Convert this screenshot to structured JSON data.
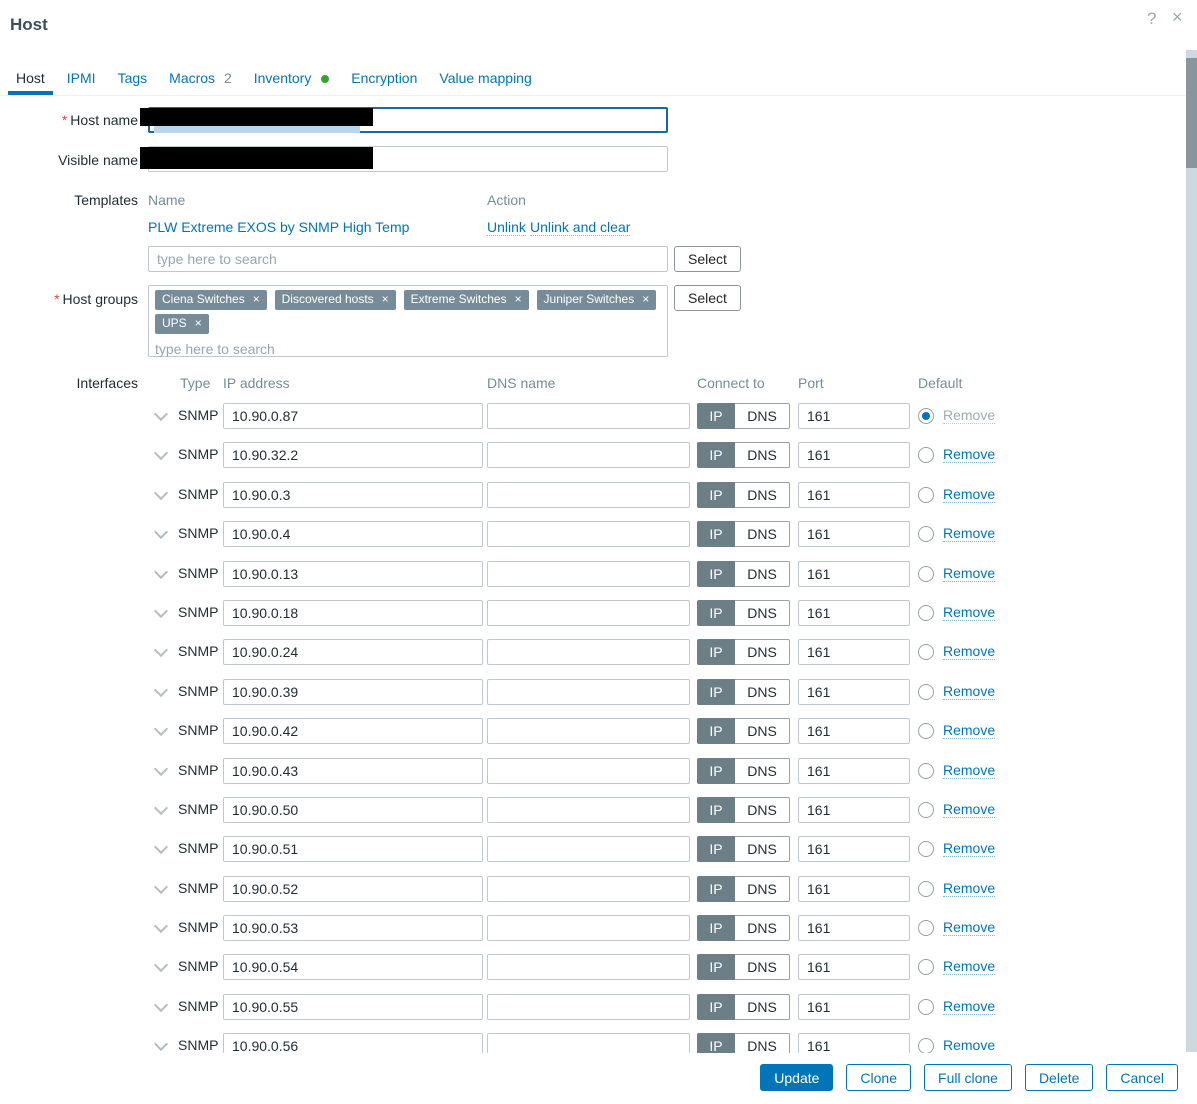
{
  "dialog": {
    "title": "Host",
    "help_icon": "?",
    "close_icon": "×"
  },
  "required_marker": "*",
  "tabs": [
    {
      "label": "Host",
      "active": true
    },
    {
      "label": "IPMI"
    },
    {
      "label": "Tags"
    },
    {
      "label": "Macros",
      "badge": "2"
    },
    {
      "label": "Inventory",
      "dot": true
    },
    {
      "label": "Encryption"
    },
    {
      "label": "Value mapping"
    }
  ],
  "form": {
    "host_name": {
      "label": "Host name",
      "required": true,
      "value": "",
      "redacted": true
    },
    "visible_name": {
      "label": "Visible name",
      "value": "",
      "redacted": true
    },
    "templates": {
      "label": "Templates",
      "name_header": "Name",
      "action_header": "Action",
      "linked": [
        {
          "name": "PLW Extreme EXOS by SNMP High Temp",
          "actions": [
            "Unlink",
            "Unlink and clear"
          ]
        }
      ],
      "search_placeholder": "type here to search",
      "select_button": "Select"
    },
    "host_groups": {
      "label": "Host groups",
      "required": true,
      "tags": [
        "Ciena Switches",
        "Discovered hosts",
        "Extreme Switches",
        "Juniper Switches",
        "UPS"
      ],
      "remove_icon": "×",
      "search_placeholder": "type here to search",
      "select_button": "Select"
    },
    "interfaces": {
      "label": "Interfaces",
      "headers": [
        "Type",
        "IP address",
        "DNS name",
        "Connect to",
        "Port",
        "Default"
      ],
      "connect_options": [
        "IP",
        "DNS"
      ],
      "rows": [
        {
          "type": "SNMP",
          "ip": "10.90.0.87",
          "dns": "",
          "connect_to": "IP",
          "port": "161",
          "default_selected": true,
          "remove_label": "Remove",
          "remove_enabled": false
        },
        {
          "type": "SNMP",
          "ip": "10.90.32.2",
          "dns": "",
          "connect_to": "IP",
          "port": "161",
          "default_selected": false,
          "remove_label": "Remove",
          "remove_enabled": true
        },
        {
          "type": "SNMP",
          "ip": "10.90.0.3",
          "dns": "",
          "connect_to": "IP",
          "port": "161",
          "default_selected": false,
          "remove_label": "Remove",
          "remove_enabled": true
        },
        {
          "type": "SNMP",
          "ip": "10.90.0.4",
          "dns": "",
          "connect_to": "IP",
          "port": "161",
          "default_selected": false,
          "remove_label": "Remove",
          "remove_enabled": true
        },
        {
          "type": "SNMP",
          "ip": "10.90.0.13",
          "dns": "",
          "connect_to": "IP",
          "port": "161",
          "default_selected": false,
          "remove_label": "Remove",
          "remove_enabled": true
        },
        {
          "type": "SNMP",
          "ip": "10.90.0.18",
          "dns": "",
          "connect_to": "IP",
          "port": "161",
          "default_selected": false,
          "remove_label": "Remove",
          "remove_enabled": true
        },
        {
          "type": "SNMP",
          "ip": "10.90.0.24",
          "dns": "",
          "connect_to": "IP",
          "port": "161",
          "default_selected": false,
          "remove_label": "Remove",
          "remove_enabled": true
        },
        {
          "type": "SNMP",
          "ip": "10.90.0.39",
          "dns": "",
          "connect_to": "IP",
          "port": "161",
          "default_selected": false,
          "remove_label": "Remove",
          "remove_enabled": true
        },
        {
          "type": "SNMP",
          "ip": "10.90.0.42",
          "dns": "",
          "connect_to": "IP",
          "port": "161",
          "default_selected": false,
          "remove_label": "Remove",
          "remove_enabled": true
        },
        {
          "type": "SNMP",
          "ip": "10.90.0.43",
          "dns": "",
          "connect_to": "IP",
          "port": "161",
          "default_selected": false,
          "remove_label": "Remove",
          "remove_enabled": true
        },
        {
          "type": "SNMP",
          "ip": "10.90.0.50",
          "dns": "",
          "connect_to": "IP",
          "port": "161",
          "default_selected": false,
          "remove_label": "Remove",
          "remove_enabled": true
        },
        {
          "type": "SNMP",
          "ip": "10.90.0.51",
          "dns": "",
          "connect_to": "IP",
          "port": "161",
          "default_selected": false,
          "remove_label": "Remove",
          "remove_enabled": true
        },
        {
          "type": "SNMP",
          "ip": "10.90.0.52",
          "dns": "",
          "connect_to": "IP",
          "port": "161",
          "default_selected": false,
          "remove_label": "Remove",
          "remove_enabled": true
        },
        {
          "type": "SNMP",
          "ip": "10.90.0.53",
          "dns": "",
          "connect_to": "IP",
          "port": "161",
          "default_selected": false,
          "remove_label": "Remove",
          "remove_enabled": true
        },
        {
          "type": "SNMP",
          "ip": "10.90.0.54",
          "dns": "",
          "connect_to": "IP",
          "port": "161",
          "default_selected": false,
          "remove_label": "Remove",
          "remove_enabled": true
        },
        {
          "type": "SNMP",
          "ip": "10.90.0.55",
          "dns": "",
          "connect_to": "IP",
          "port": "161",
          "default_selected": false,
          "remove_label": "Remove",
          "remove_enabled": true
        },
        {
          "type": "SNMP",
          "ip": "10.90.0.56",
          "dns": "",
          "connect_to": "IP",
          "port": "161",
          "default_selected": false,
          "remove_label": "Remove",
          "remove_enabled": true
        }
      ]
    }
  },
  "footer": {
    "buttons": [
      {
        "label": "Update",
        "primary": true
      },
      {
        "label": "Clone"
      },
      {
        "label": "Full clone"
      },
      {
        "label": "Delete"
      },
      {
        "label": "Cancel"
      }
    ]
  },
  "colors": {
    "link": "#0275b8",
    "primary_button": "#0275b8",
    "tag_background": "#768d99",
    "segment_active_background": "#6c7f87",
    "inventory_dot": "#33a433",
    "column_header_text": "#768d99",
    "title_text": "#3b5160"
  }
}
